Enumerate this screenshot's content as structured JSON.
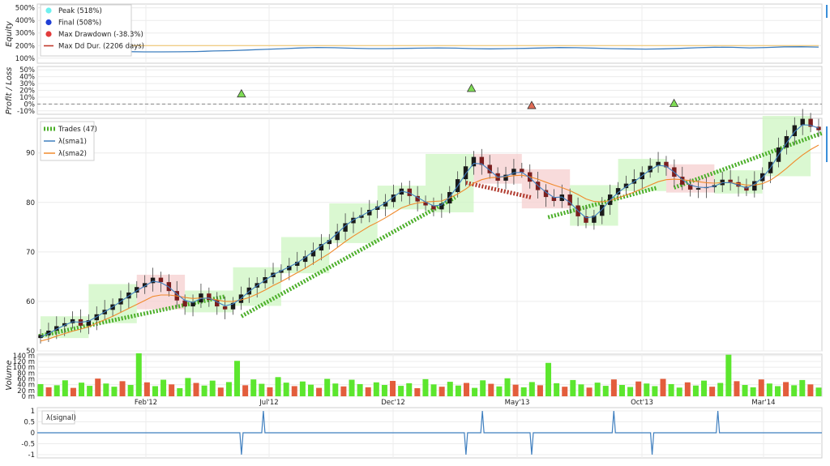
{
  "chart_data": [
    {
      "type": "line",
      "panel": "equity",
      "ylabel": "Equity",
      "yticks": [
        "500%",
        "400%",
        "300%",
        "200%",
        "100%"
      ],
      "ylim": [
        60,
        530
      ],
      "legend_placement": "top-left",
      "legend": [
        {
          "label": "Peak (518%)",
          "color": "#6ff0ef",
          "marker": "circle"
        },
        {
          "label": "Final (508%)",
          "color": "#1f3fd6",
          "marker": "circle"
        },
        {
          "label": "Max Drawdown (-38.3%)",
          "color": "#e23b3b",
          "marker": "circle"
        },
        {
          "label": "Max Dd Dur. (2206 days)",
          "color": "#c0392b",
          "marker": "line"
        }
      ],
      "series": [
        {
          "values": [
            152,
            150,
            153,
            158,
            156,
            152,
            150,
            150,
            151,
            153,
            157,
            160,
            165,
            170,
            175,
            181,
            185,
            183,
            179,
            176,
            176,
            178,
            180,
            182,
            180,
            176,
            174,
            176,
            178,
            181,
            184,
            183,
            180,
            176,
            174,
            172,
            174,
            178,
            183,
            187,
            186,
            182,
            185,
            190,
            191,
            188
          ]
        }
      ],
      "peak_line_value": 200,
      "peak_line_color": "#f0c060"
    },
    {
      "type": "scatter",
      "panel": "profit-loss",
      "ylabel": "Profit / Loss",
      "yticks": [
        "50%",
        "40%",
        "30%",
        "20%",
        "10%",
        "0%",
        "-10%"
      ],
      "ylim": [
        -15,
        55
      ],
      "baseline": 0,
      "points": [
        {
          "x": "2012-06-18",
          "y": 15,
          "result": "win"
        },
        {
          "x": "2013-04-08",
          "y": 23,
          "result": "win"
        },
        {
          "x": "2013-06-24",
          "y": -2,
          "result": "loss"
        },
        {
          "x": "2013-12-23",
          "y": 1,
          "result": "win"
        }
      ]
    },
    {
      "type": "candlestick",
      "panel": "price",
      "yticks": [
        "90",
        "80",
        "70",
        "60",
        "50"
      ],
      "ylim": [
        50,
        97
      ],
      "legend_placement": "top-left",
      "legend": [
        {
          "label": "Trades (47)",
          "color": "#4caf2a",
          "marker": "dashed-thick"
        },
        {
          "label": "λ(sma1)",
          "color": "#3f7fbf",
          "marker": "line"
        },
        {
          "label": "λ(sma2)",
          "color": "#f08a2c",
          "marker": "line"
        }
      ],
      "close": [
        53.2,
        54.1,
        55.0,
        55.6,
        56.4,
        55.1,
        56.2,
        57.4,
        58.3,
        59.4,
        60.6,
        61.8,
        62.9,
        63.7,
        64.8,
        63.9,
        62.1,
        60.2,
        59.0,
        59.8,
        61.6,
        60.3,
        59.0,
        58.4,
        59.7,
        61.4,
        62.8,
        63.7,
        64.9,
        65.8,
        66.3,
        67.2,
        68.0,
        69.1,
        70.3,
        71.6,
        72.4,
        74.1,
        75.8,
        76.9,
        77.4,
        78.5,
        79.2,
        80.1,
        81.6,
        82.8,
        81.3,
        80.2,
        79.4,
        78.6,
        79.8,
        82.1,
        84.7,
        87.3,
        89.2,
        87.6,
        85.9,
        84.4,
        85.6,
        86.8,
        86.1,
        84.2,
        82.5,
        81.1,
        80.3,
        81.6,
        79.4,
        77.2,
        75.9,
        77.3,
        79.5,
        81.6,
        82.9,
        83.8,
        84.7,
        86.1,
        87.4,
        88.2,
        87.1,
        85.2,
        83.6,
        82.6,
        82.9,
        83.1,
        83.5,
        84.6,
        84.1,
        83.2,
        82.4,
        84.3,
        85.9,
        88.2,
        91.1,
        93.4,
        95.6,
        96.9,
        95.3,
        94.6
      ],
      "sma1": [
        52.8,
        53.5,
        54.4,
        55.2,
        55.9,
        55.8,
        56.0,
        56.9,
        57.9,
        58.9,
        60.0,
        61.1,
        62.2,
        63.1,
        64.1,
        63.8,
        62.9,
        61.5,
        60.2,
        59.8,
        60.6,
        60.7,
        59.9,
        59.1,
        59.5,
        60.6,
        62.0,
        63.2,
        64.3,
        65.4,
        66.2,
        67.0,
        67.8,
        68.9,
        70.1,
        71.3,
        72.3,
        73.8,
        75.3,
        76.5,
        77.3,
        78.2,
        79.0,
        79.9,
        81.1,
        82.3,
        81.9,
        81.0,
        80.1,
        79.3,
        79.5,
        81.1,
        83.3,
        85.8,
        87.9,
        87.8,
        86.5,
        85.1,
        85.3,
        86.0,
        86.1,
        85.0,
        83.4,
        82.1,
        81.0,
        81.1,
        80.0,
        78.3,
        76.9,
        77.1,
        78.6,
        80.5,
        82.0,
        83.2,
        84.2,
        85.4,
        86.6,
        87.5,
        87.3,
        86.1,
        84.6,
        83.5,
        83.1,
        83.0,
        83.3,
        84.0,
        84.0,
        83.5,
        82.9,
        83.7,
        85.0,
        87.0,
        89.6,
        92.0,
        94.3,
        95.7,
        95.6,
        95.0
      ],
      "sma2": [
        52.0,
        52.4,
        53.0,
        53.5,
        54.0,
        54.4,
        54.9,
        55.6,
        56.3,
        57.0,
        57.8,
        58.6,
        59.4,
        60.2,
        61.0,
        61.3,
        61.3,
        61.1,
        60.8,
        60.6,
        60.7,
        60.6,
        60.3,
        60.0,
        60.0,
        60.3,
        60.8,
        61.5,
        62.3,
        63.2,
        64.0,
        64.9,
        65.8,
        66.7,
        67.7,
        68.7,
        69.7,
        70.9,
        72.1,
        73.2,
        74.2,
        75.2,
        76.0,
        76.9,
        77.9,
        78.9,
        79.5,
        79.9,
        80.1,
        80.2,
        80.3,
        80.9,
        81.7,
        82.7,
        83.9,
        84.6,
        85.0,
        85.1,
        85.2,
        85.4,
        85.5,
        85.2,
        84.7,
        84.1,
        83.5,
        83.0,
        82.4,
        81.6,
        80.7,
        80.2,
        80.1,
        80.4,
        80.9,
        81.5,
        82.1,
        82.8,
        83.5,
        84.2,
        84.6,
        84.7,
        84.6,
        84.4,
        84.2,
        84.0,
        83.9,
        84.0,
        84.0,
        83.8,
        83.5,
        83.5,
        83.8,
        84.5,
        85.6,
        86.9,
        88.3,
        89.6,
        90.7,
        91.6
      ],
      "trades": [
        {
          "entry_x": "2011-10-03",
          "entry_y": 53,
          "exit_x": "2012-05-28",
          "exit_y": 61,
          "result": "win"
        },
        {
          "entry_x": "2012-06-18",
          "entry_y": 57,
          "exit_x": "2013-03-18",
          "exit_y": 81,
          "result": "win"
        },
        {
          "entry_x": "2013-04-01",
          "entry_y": 84,
          "exit_x": "2013-06-24",
          "exit_y": 81,
          "result": "loss"
        },
        {
          "entry_x": "2013-07-15",
          "entry_y": 77,
          "exit_x": "2013-12-02",
          "exit_y": 83,
          "result": "win"
        },
        {
          "entry_x": "2013-12-23",
          "entry_y": 83,
          "exit_x": "2014-06-30",
          "exit_y": 94,
          "result": "win"
        }
      ]
    },
    {
      "type": "bar",
      "panel": "volume",
      "ylabel": "Volume",
      "yticks": [
        "140 m",
        "120 m",
        "100 m",
        "80 m",
        "60 m",
        "40 m",
        "20 m",
        "0 m"
      ],
      "ylim": [
        0,
        145
      ],
      "bar_colors": {
        "up": "#5ce62e",
        "down": "#e35d3c"
      },
      "values": [
        42,
        31,
        38,
        55,
        29,
        47,
        36,
        61,
        44,
        33,
        52,
        39,
        148,
        48,
        35,
        57,
        41,
        28,
        63,
        46,
        37,
        54,
        30,
        49,
        122,
        38,
        58,
        43,
        31,
        66,
        47,
        35,
        51,
        40,
        29,
        60,
        44,
        34,
        57,
        42,
        31,
        48,
        39,
        53,
        36,
        45,
        28,
        59,
        41,
        33,
        50,
        37,
        46,
        29,
        55,
        43,
        34,
        62,
        40,
        31,
        49,
        38,
        115,
        45,
        33,
        56,
        41,
        30,
        47,
        36,
        58,
        39,
        32,
        51,
        44,
        35,
        60,
        42,
        30,
        48,
        37,
        54,
        33,
        46,
        143,
        52,
        39,
        31,
        58,
        44,
        35,
        49,
        38,
        56,
        41,
        30
      ]
    },
    {
      "type": "line",
      "panel": "signal",
      "yticks": [
        "1",
        "0.5",
        "0",
        "-0.5",
        "-1"
      ],
      "ylim": [
        -1.15,
        1.15
      ],
      "xlim": [
        "2011-10-01",
        "2014-06-30"
      ],
      "legend": [
        {
          "label": "λ(signal)",
          "color": "#3f7fbf"
        }
      ],
      "spikes": [
        {
          "x": "2012-06-18",
          "y": -1
        },
        {
          "x": "2012-07-16",
          "y": 1
        },
        {
          "x": "2013-04-01",
          "y": -1
        },
        {
          "x": "2013-04-22",
          "y": 1
        },
        {
          "x": "2013-06-24",
          "y": -1
        },
        {
          "x": "2013-10-07",
          "y": 1
        },
        {
          "x": "2013-11-25",
          "y": -1
        },
        {
          "x": "2014-02-17",
          "y": 1
        }
      ]
    }
  ],
  "x_axis": {
    "ticks": [
      "Feb'12",
      "Jul'12",
      "Dec'12",
      "May'13",
      "Oct'13",
      "Mar'14"
    ]
  },
  "colors": {
    "candle_up": "#1a1a1a",
    "candle_down": "#7a1e1e",
    "win_zone": "#cdf6c2",
    "loss_zone": "#f6cfcf",
    "sma1": "#3f7fbf",
    "sma2": "#f08a2c",
    "trade_win": "#4caf2a",
    "trade_loss": "#b03a2e",
    "equity": "#3f7fbf"
  }
}
